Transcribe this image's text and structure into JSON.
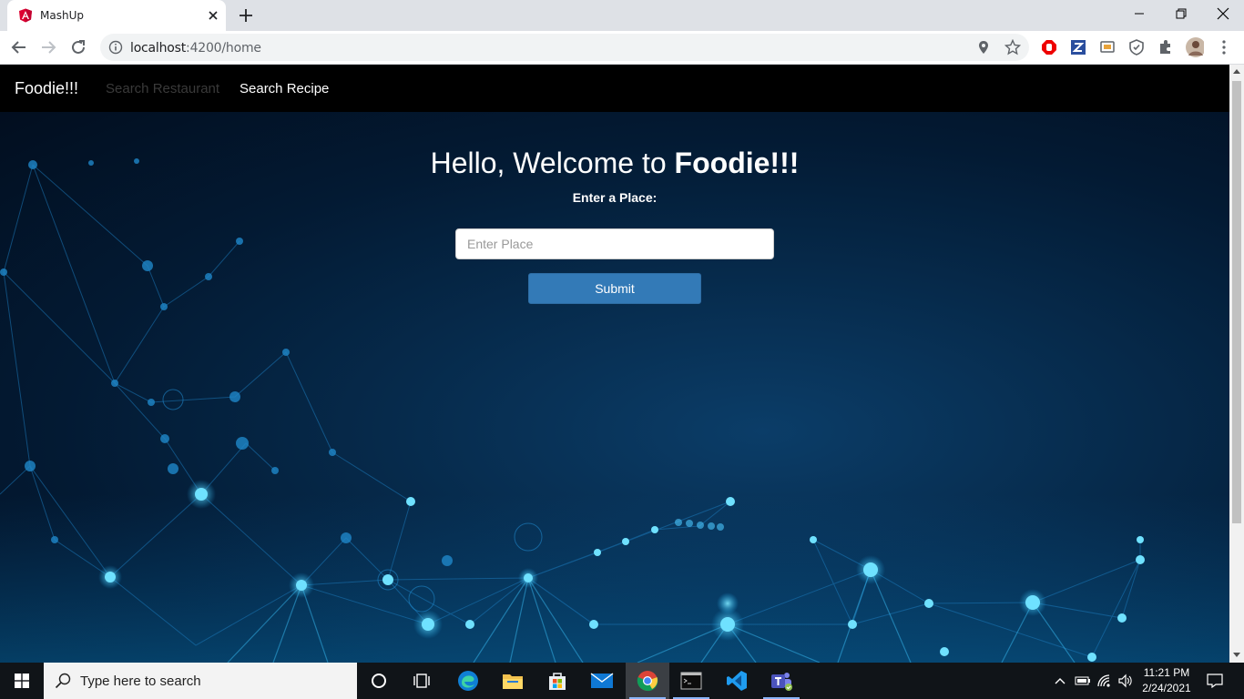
{
  "browser": {
    "tab_title": "MashUp",
    "url_host": "localhost",
    "url_path": ":4200/home"
  },
  "navbar": {
    "brand": "Foodie!!!",
    "links": [
      "Search Restaurant",
      "Search Recipe"
    ]
  },
  "hero": {
    "welcome_prefix": "Hello, Welcome to ",
    "welcome_brand": "Foodie!!!",
    "place_label": "Enter a Place:",
    "place_placeholder": "Enter Place",
    "submit_label": "Submit"
  },
  "taskbar": {
    "search_placeholder": "Type here to search",
    "time": "11:21 PM",
    "date": "2/24/2021"
  },
  "colors": {
    "primary_button": "#337ab7",
    "navbar_bg": "#000000",
    "hero_bg": "#062a4b"
  }
}
